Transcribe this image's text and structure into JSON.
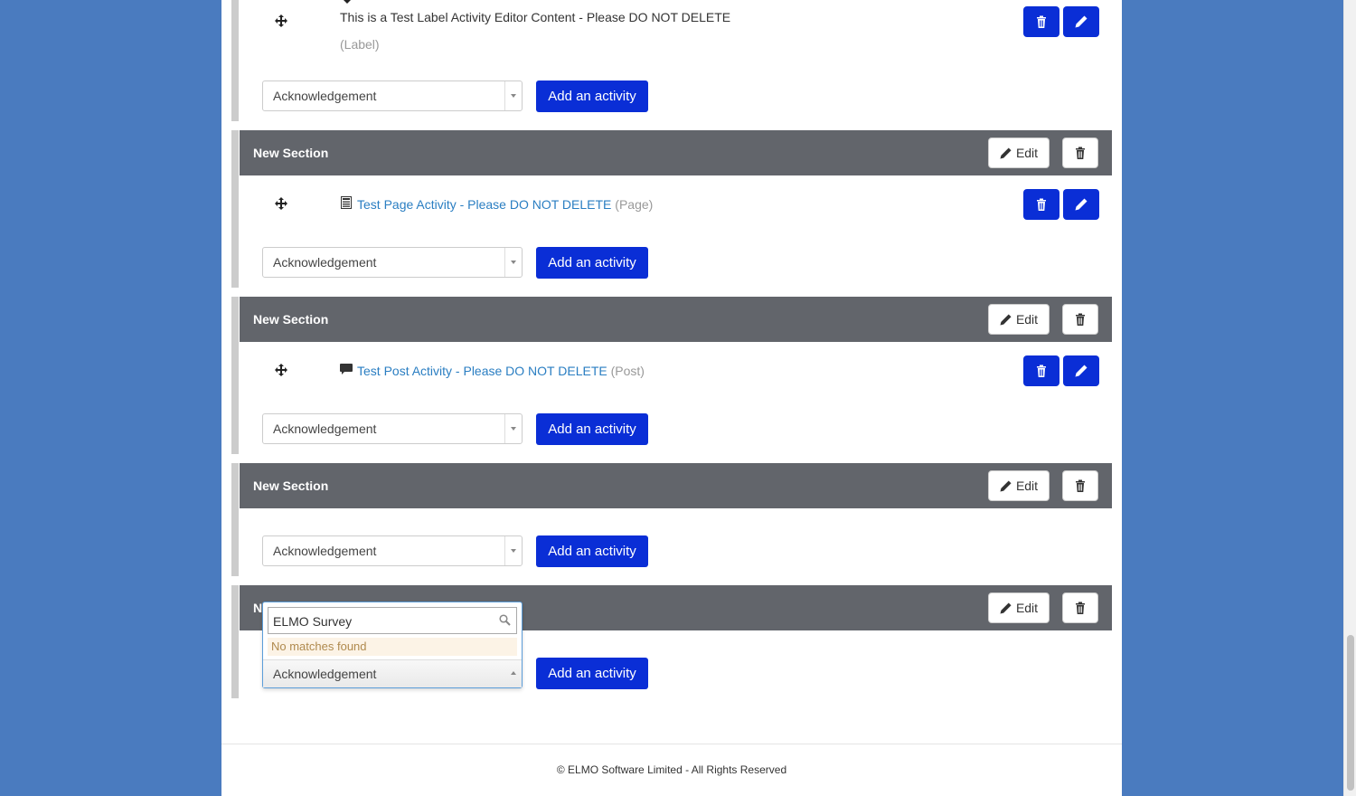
{
  "colors": {
    "background_blue": "#4a7bbf",
    "section_header": "#62656b",
    "primary_button": "#0a2ed6",
    "link": "#2a7ec2"
  },
  "top_activity": {
    "content": "This is a Test Label Activity Editor Content - Please DO NOT DELETE",
    "type": "(Label)",
    "move_icon": "move-icon"
  },
  "add_row": {
    "select_value": "Acknowledgement",
    "button_label": "Add an activity"
  },
  "sections": [
    {
      "title": "New Section",
      "edit_label": "Edit",
      "activity": {
        "icon": "page-icon",
        "title": "Test Page Activity - Please DO NOT DELETE",
        "type": "(Page)"
      }
    },
    {
      "title": "New Section",
      "edit_label": "Edit",
      "activity": {
        "icon": "comment-icon",
        "title": "Test Post Activity - Please DO NOT DELETE",
        "type": "(Post)"
      }
    },
    {
      "title": "New Section",
      "edit_label": "Edit"
    },
    {
      "title": "N",
      "edit_label": "Edit"
    }
  ],
  "open_dropdown": {
    "search_value": "ELMO Survey",
    "no_results": "No matches found",
    "current_value": "Acknowledgement"
  },
  "footer": {
    "copyright": "© ELMO Software Limited - All Rights Reserved"
  }
}
